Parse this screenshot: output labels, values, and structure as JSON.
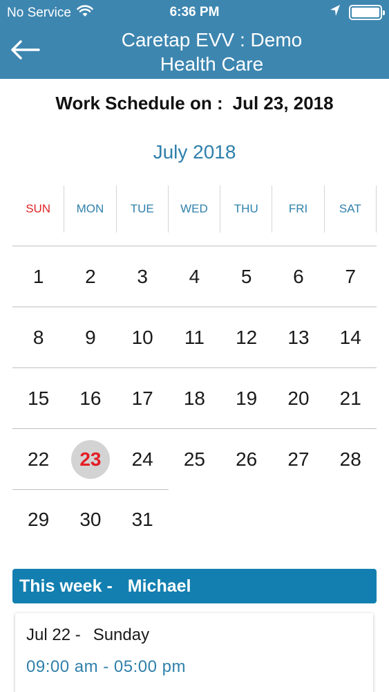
{
  "status_bar": {
    "carrier": "No Service",
    "time": "6:36 PM"
  },
  "header": {
    "title_line1": "Caretap EVV : Demo",
    "title_line2": "Health Care",
    "background_color": "#3d86b0"
  },
  "schedule": {
    "label": "Work Schedule on :",
    "date": "Jul 23, 2018"
  },
  "calendar": {
    "month_label": "July 2018",
    "weekdays": [
      "SUN",
      "MON",
      "TUE",
      "WED",
      "THU",
      "FRI",
      "SAT"
    ],
    "weeks": [
      [
        "1",
        "2",
        "3",
        "4",
        "5",
        "6",
        "7"
      ],
      [
        "8",
        "9",
        "10",
        "11",
        "12",
        "13",
        "14"
      ],
      [
        "15",
        "16",
        "17",
        "18",
        "19",
        "20",
        "21"
      ],
      [
        "22",
        "23",
        "24",
        "25",
        "26",
        "27",
        "28"
      ],
      [
        "29",
        "30",
        "31"
      ]
    ],
    "selected_day": "23",
    "accent_color": "#2f80ab",
    "sunday_color": "#e02424",
    "today_color": "#e41e26"
  },
  "this_week": {
    "label": "This week -",
    "name": "Michael",
    "bar_color": "#137fb0"
  },
  "shifts": [
    {
      "date": "Jul 22 -",
      "weekday": "Sunday",
      "hours": "09:00 am - 05:00 pm"
    }
  ]
}
